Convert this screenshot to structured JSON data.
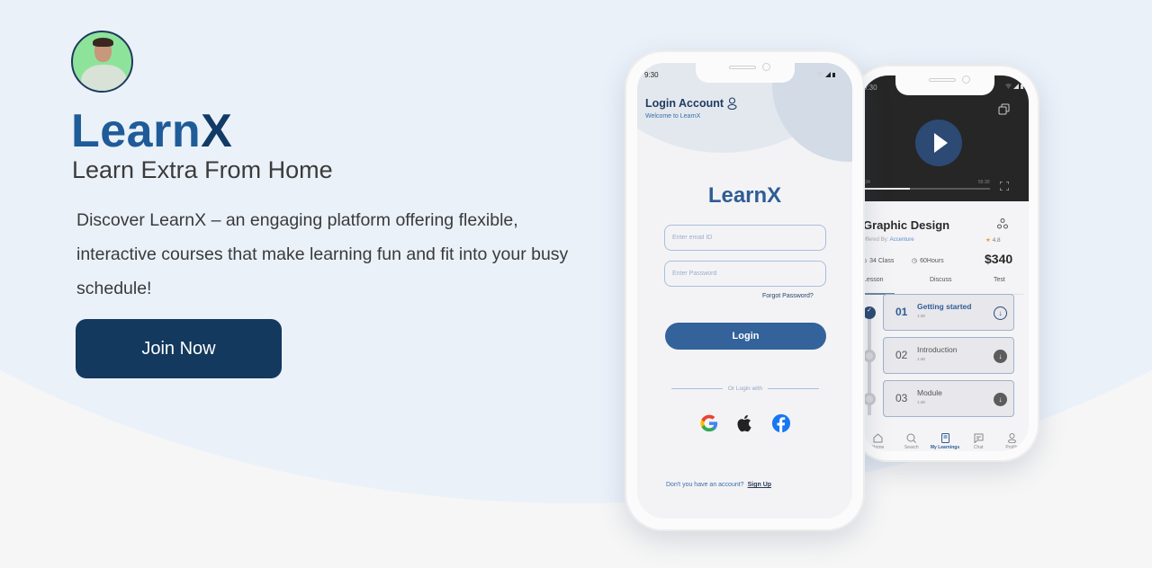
{
  "hero": {
    "brand_main": "Learn",
    "brand_x": "X",
    "tagline": "Learn Extra From Home",
    "description": "Discover LearnX – an engaging platform offering flexible, interactive courses that make learning fun and fit into your busy schedule!",
    "cta_label": "Join Now",
    "avatar_icon": "profile-photo"
  },
  "colors": {
    "brand_blue": "#1f5b98",
    "navy": "#13395e",
    "button_blue": "#33639a",
    "background": "#eaf1f9"
  },
  "login_screen": {
    "status_time": "9:30",
    "title": "Login Account",
    "title_icon": "user-icon",
    "subtitle": "Welcome to LearnX",
    "logo_text": "LearnX",
    "email_placeholder": "Enter email ID",
    "password_placeholder": "Enter Password",
    "forgot_label": "Forgot Password?",
    "login_label": "Login",
    "divider_label": "Or Login with",
    "social": [
      {
        "name": "google",
        "icon": "google-icon"
      },
      {
        "name": "apple",
        "icon": "apple-icon"
      },
      {
        "name": "facebook",
        "icon": "facebook-icon"
      }
    ],
    "signup_prompt": "Don't you have an account?",
    "signup_label": "Sign Up"
  },
  "course_screen": {
    "status_time": "9:30",
    "video": {
      "elapsed": "0:34",
      "total": "55:30",
      "progress": 0.38
    },
    "title": "Graphic Design",
    "offered_by_label": "Offered By:",
    "offered_by": "Accenture",
    "rating": "4.8",
    "classes": "34 Class",
    "hours": "60Hours",
    "price": "$340",
    "tabs": [
      {
        "label": "Lesson",
        "active": true
      },
      {
        "label": "Discuss",
        "active": false
      },
      {
        "label": "Test",
        "active": false
      }
    ],
    "lessons": [
      {
        "num": "01",
        "name": "Getting started",
        "duration": "1:48",
        "done": true
      },
      {
        "num": "02",
        "name": "Introduction",
        "duration": "1:48",
        "done": false
      },
      {
        "num": "03",
        "name": "Module",
        "duration": "1:48",
        "done": false
      }
    ],
    "nav": [
      {
        "label": "Home",
        "icon": "home-icon",
        "active": false
      },
      {
        "label": "Search",
        "icon": "search-icon",
        "active": false
      },
      {
        "label": "My Learnings",
        "icon": "book-icon",
        "active": true
      },
      {
        "label": "Chat",
        "icon": "chat-icon",
        "active": false
      },
      {
        "label": "Profile",
        "icon": "profile-icon",
        "active": false
      }
    ]
  }
}
